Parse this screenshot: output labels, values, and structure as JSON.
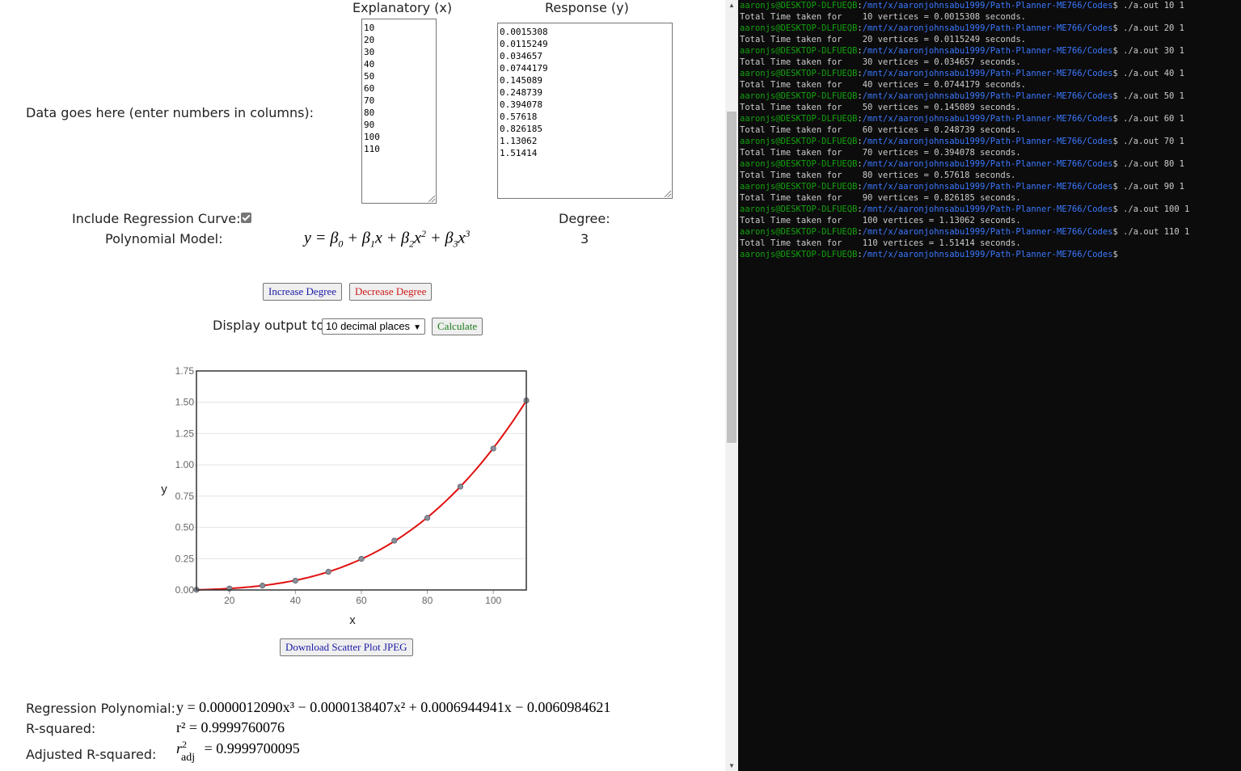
{
  "form": {
    "data_label": "Data goes here (enter numbers in columns):",
    "explanatory_label": "Explanatory (x)",
    "response_label": "Response (y)",
    "x_values": [
      "10",
      "20",
      "30",
      "40",
      "50",
      "60",
      "70",
      "80",
      "90",
      "100",
      "110"
    ],
    "y_values": [
      "0.0015308",
      "0.0115249",
      "0.034657",
      "0.0744179",
      "0.145089",
      "0.248739",
      "0.394078",
      "0.57618",
      "0.826185",
      "1.13062",
      "1.51414"
    ],
    "include_regression_label": "Include Regression Curve:",
    "include_regression_checked": true,
    "degree_label": "Degree:",
    "degree_value": "3",
    "model_label": "Polynomial Model:",
    "increase_degree": "Increase Degree",
    "decrease_degree": "Decrease Degree",
    "display_output_label": "Display output to",
    "decimal_places_selected": "10 decimal places",
    "calculate": "Calculate",
    "download": "Download Scatter Plot JPEG",
    "colors": {
      "increase": "#1a1aa6",
      "decrease": "#d11a1a",
      "calculate": "#1a7a1a",
      "download": "#1a1aa6"
    }
  },
  "results": {
    "regression_label": "Regression Polynomial:",
    "regression_eq": "y = 0.0000012090x³ − 0.0000138407x² + 0.0006944941x − 0.0060984621",
    "rsquared_label": "R-squared:",
    "rsquared_eq": "r² = 0.9999760076",
    "adj_label": "Adjusted R-squared:",
    "adj_value": "= 0.9999700095"
  },
  "chart_data": {
    "type": "scatter",
    "xlabel": "x",
    "ylabel": "y",
    "xlim": [
      10,
      110
    ],
    "ylim": [
      0,
      1.75
    ],
    "xticks": [
      "20",
      "40",
      "60",
      "80",
      "100"
    ],
    "yticks": [
      "0.00",
      "0.25",
      "0.50",
      "0.75",
      "1.00",
      "1.25",
      "1.50",
      "1.75"
    ],
    "grid": "horizontal",
    "x": [
      10,
      20,
      30,
      40,
      50,
      60,
      70,
      80,
      90,
      100,
      110
    ],
    "y": [
      0.0015308,
      0.0115249,
      0.034657,
      0.0744179,
      0.145089,
      0.248739,
      0.394078,
      0.57618,
      0.826185,
      1.13062,
      1.51414
    ],
    "curve": {
      "color": "#e01010",
      "b0": -0.0060984621,
      "b1": 0.0006944941,
      "b2": -1.38407e-05,
      "b3": 1.209e-06
    },
    "point_color": "#8a8f99"
  },
  "terminal": {
    "user": "aaronjs@DESKTOP-DLFUEQB",
    "path": "/mnt/x/aaronjohnsabu1999/Path-Planner-ME766/Codes",
    "runs": [
      {
        "cmd": "./a.out 10 1",
        "output": "Total Time taken for    10 vertices = 0.0015308 seconds."
      },
      {
        "cmd": "./a.out 20 1",
        "output": "Total Time taken for    20 vertices = 0.0115249 seconds."
      },
      {
        "cmd": "./a.out 30 1",
        "output": "Total Time taken for    30 vertices = 0.034657 seconds."
      },
      {
        "cmd": "./a.out 40 1",
        "output": "Total Time taken for    40 vertices = 0.0744179 seconds."
      },
      {
        "cmd": "./a.out 50 1",
        "output": "Total Time taken for    50 vertices = 0.145089 seconds."
      },
      {
        "cmd": "./a.out 60 1",
        "output": "Total Time taken for    60 vertices = 0.248739 seconds."
      },
      {
        "cmd": "./a.out 70 1",
        "output": "Total Time taken for    70 vertices = 0.394078 seconds."
      },
      {
        "cmd": "./a.out 80 1",
        "output": "Total Time taken for    80 vertices = 0.57618 seconds."
      },
      {
        "cmd": "./a.out 90 1",
        "output": "Total Time taken for    90 vertices = 0.826185 seconds."
      },
      {
        "cmd": "./a.out 100 1",
        "output": "Total Time taken for    100 vertices = 1.13062 seconds."
      },
      {
        "cmd": "./a.out 110 1",
        "output": "Total Time taken for    110 vertices = 1.51414 seconds."
      }
    ],
    "prompt_suffix": "$"
  }
}
